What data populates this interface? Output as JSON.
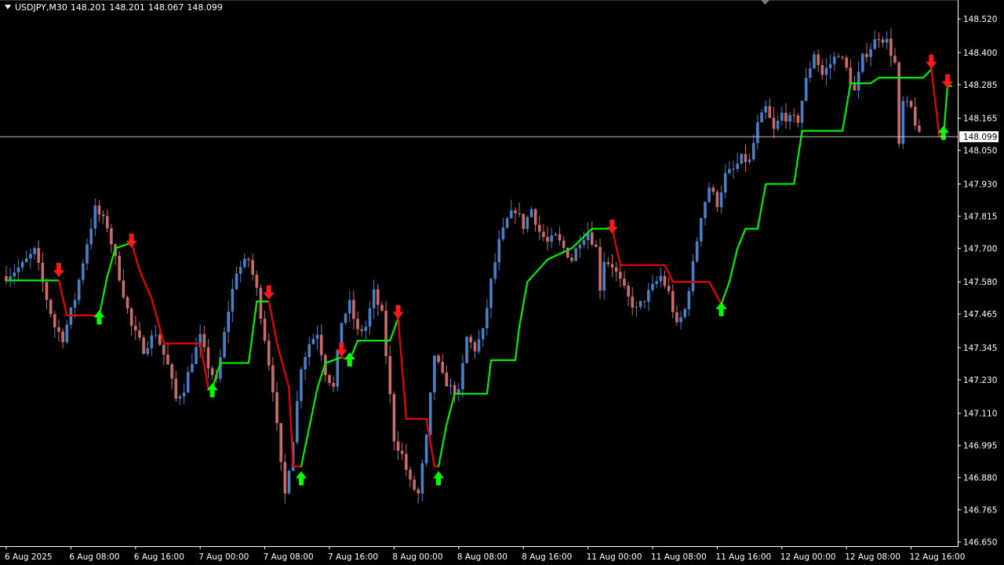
{
  "header": {
    "symbol": "USDJPY,M30",
    "open": "148.201",
    "high": "148.201",
    "low": "148.067",
    "close": "148.099"
  },
  "colors": {
    "background": "#000000",
    "frame": "#ffffff",
    "bull_candle": "#4a7fc6",
    "bear_candle": "#c96b6b",
    "trend_up": "#00ee00",
    "trend_down": "#ee0000",
    "arrow_up": "#00ff00",
    "arrow_down": "#ff1a1a",
    "price_line": "#c0c0c0",
    "text": "#ffffff"
  },
  "chart_data": {
    "type": "candlestick",
    "symbol": "USDJPY",
    "timeframe": "M30",
    "ylim": [
      146.635,
      148.585
    ],
    "grid": false,
    "current_price": "148.099",
    "y_ticks": [
      "148.520",
      "148.400",
      "148.285",
      "148.165",
      "148.050",
      "147.930",
      "147.815",
      "147.700",
      "147.580",
      "147.465",
      "147.345",
      "147.230",
      "147.110",
      "146.995",
      "146.880",
      "146.765",
      "146.650"
    ],
    "x_ticks": [
      "6 Aug 2025",
      "6 Aug 08:00",
      "6 Aug 16:00",
      "7 Aug 00:00",
      "7 Aug 08:00",
      "7 Aug 16:00",
      "8 Aug 00:00",
      "8 Aug 08:00",
      "8 Aug 16:00",
      "11 Aug 00:00",
      "11 Aug 08:00",
      "11 Aug 16:00",
      "12 Aug 00:00",
      "12 Aug 08:00",
      "12 Aug 16:00"
    ],
    "x_tick_bar_index": [
      0,
      16,
      32,
      48,
      64,
      80,
      96,
      112,
      128,
      144,
      160,
      176,
      192,
      208,
      224
    ],
    "path": [
      [
        0,
        147.6
      ],
      [
        4,
        147.64
      ],
      [
        7,
        147.69
      ],
      [
        10,
        147.52
      ],
      [
        12,
        147.42
      ],
      [
        14,
        147.38
      ],
      [
        17,
        147.52
      ],
      [
        20,
        147.72
      ],
      [
        22,
        147.84
      ],
      [
        25,
        147.78
      ],
      [
        28,
        147.6
      ],
      [
        31,
        147.42
      ],
      [
        34,
        147.34
      ],
      [
        37,
        147.4
      ],
      [
        40,
        147.28
      ],
      [
        42,
        147.16
      ],
      [
        44,
        147.2
      ],
      [
        46,
        147.3
      ],
      [
        48,
        147.38
      ],
      [
        50,
        147.28
      ],
      [
        52,
        147.22
      ],
      [
        55,
        147.48
      ],
      [
        57,
        147.62
      ],
      [
        60,
        147.66
      ],
      [
        62,
        147.55
      ],
      [
        64,
        147.38
      ],
      [
        66,
        147.2
      ],
      [
        68,
        146.92
      ],
      [
        69,
        146.82
      ],
      [
        71,
        147.02
      ],
      [
        73,
        147.28
      ],
      [
        75,
        147.36
      ],
      [
        77,
        147.4
      ],
      [
        79,
        147.26
      ],
      [
        81,
        147.2
      ],
      [
        83,
        147.44
      ],
      [
        85,
        147.5
      ],
      [
        87,
        147.4
      ],
      [
        89,
        147.42
      ],
      [
        91,
        147.54
      ],
      [
        93,
        147.46
      ],
      [
        94,
        147.32
      ],
      [
        96,
        147.02
      ],
      [
        98,
        146.96
      ],
      [
        100,
        146.86
      ],
      [
        102,
        146.82
      ],
      [
        104,
        147.02
      ],
      [
        106,
        147.32
      ],
      [
        108,
        147.24
      ],
      [
        110,
        147.2
      ],
      [
        112,
        147.18
      ],
      [
        114,
        147.38
      ],
      [
        116,
        147.34
      ],
      [
        118,
        147.4
      ],
      [
        120,
        147.58
      ],
      [
        122,
        147.72
      ],
      [
        124,
        147.8
      ],
      [
        126,
        147.84
      ],
      [
        128,
        147.78
      ],
      [
        130,
        147.84
      ],
      [
        132,
        147.76
      ],
      [
        134,
        147.72
      ],
      [
        136,
        147.74
      ],
      [
        138,
        147.7
      ],
      [
        140,
        147.66
      ],
      [
        142,
        147.73
      ],
      [
        144,
        147.76
      ],
      [
        146,
        147.7
      ],
      [
        147,
        147.56
      ],
      [
        148,
        147.66
      ],
      [
        150,
        147.64
      ],
      [
        152,
        147.58
      ],
      [
        154,
        147.52
      ],
      [
        156,
        147.48
      ],
      [
        158,
        147.52
      ],
      [
        160,
        147.56
      ],
      [
        162,
        147.6
      ],
      [
        164,
        147.54
      ],
      [
        166,
        147.42
      ],
      [
        168,
        147.48
      ],
      [
        170,
        147.64
      ],
      [
        172,
        147.82
      ],
      [
        174,
        147.92
      ],
      [
        176,
        147.86
      ],
      [
        178,
        147.96
      ],
      [
        180,
        147.98
      ],
      [
        182,
        148.02
      ],
      [
        184,
        148.01
      ],
      [
        186,
        148.14
      ],
      [
        188,
        148.2
      ],
      [
        190,
        148.12
      ],
      [
        192,
        148.18
      ],
      [
        194,
        148.16
      ],
      [
        196,
        148.16
      ],
      [
        198,
        148.3
      ],
      [
        200,
        148.4
      ],
      [
        202,
        148.32
      ],
      [
        204,
        148.36
      ],
      [
        206,
        148.4
      ],
      [
        208,
        148.34
      ],
      [
        210,
        148.26
      ],
      [
        212,
        148.38
      ],
      [
        214,
        148.42
      ],
      [
        216,
        148.46
      ],
      [
        218,
        148.44
      ],
      [
        220,
        148.36
      ],
      [
        221,
        148.06
      ],
      [
        222,
        148.22
      ],
      [
        224,
        148.2
      ],
      [
        226,
        148.1
      ]
    ],
    "arrows": [
      {
        "bar": 13,
        "direction": "down",
        "price": 147.625
      },
      {
        "bar": 23,
        "direction": "up",
        "price": 147.45
      },
      {
        "bar": 31,
        "direction": "down",
        "price": 147.73
      },
      {
        "bar": 51,
        "direction": "up",
        "price": 147.19
      },
      {
        "bar": 65,
        "direction": "down",
        "price": 147.545
      },
      {
        "bar": 73,
        "direction": "up",
        "price": 146.875
      },
      {
        "bar": 83,
        "direction": "down",
        "price": 147.34
      },
      {
        "bar": 85,
        "direction": "up",
        "price": 147.3
      },
      {
        "bar": 97,
        "direction": "down",
        "price": 147.475
      },
      {
        "bar": 107,
        "direction": "up",
        "price": 146.875
      },
      {
        "bar": 150,
        "direction": "down",
        "price": 147.78
      },
      {
        "bar": 177,
        "direction": "up",
        "price": 147.48
      },
      {
        "bar": 229,
        "direction": "down",
        "price": 148.37
      },
      {
        "bar": 232,
        "direction": "up",
        "price": 148.11
      },
      {
        "bar": 233,
        "direction": "down",
        "price": 148.3
      }
    ],
    "trend_line": [
      [
        0,
        147.585,
        "up"
      ],
      [
        13,
        147.585,
        "up"
      ],
      [
        13,
        147.585,
        "down"
      ],
      [
        15,
        147.46,
        "down"
      ],
      [
        20,
        147.46,
        "down"
      ],
      [
        23,
        147.46,
        "down"
      ],
      [
        23,
        147.46,
        "up"
      ],
      [
        25,
        147.6,
        "up"
      ],
      [
        27,
        147.7,
        "up"
      ],
      [
        31,
        147.72,
        "up"
      ],
      [
        31,
        147.72,
        "down"
      ],
      [
        33,
        147.62,
        "down"
      ],
      [
        36,
        147.52,
        "down"
      ],
      [
        39,
        147.36,
        "down"
      ],
      [
        48,
        147.36,
        "down"
      ],
      [
        50,
        147.2,
        "down"
      ],
      [
        51,
        147.2,
        "down"
      ],
      [
        51,
        147.2,
        "up"
      ],
      [
        53,
        147.29,
        "up"
      ],
      [
        60,
        147.29,
        "up"
      ],
      [
        62,
        147.51,
        "up"
      ],
      [
        65,
        147.51,
        "up"
      ],
      [
        65,
        147.51,
        "down"
      ],
      [
        67,
        147.36,
        "down"
      ],
      [
        70,
        147.2,
        "down"
      ],
      [
        71,
        146.92,
        "down"
      ],
      [
        73,
        146.92,
        "down"
      ],
      [
        73,
        146.92,
        "up"
      ],
      [
        75,
        147.06,
        "up"
      ],
      [
        77,
        147.2,
        "up"
      ],
      [
        79,
        147.29,
        "up"
      ],
      [
        83,
        147.31,
        "up"
      ],
      [
        83,
        147.31,
        "down"
      ],
      [
        85,
        147.3,
        "down"
      ],
      [
        85,
        147.3,
        "up"
      ],
      [
        87,
        147.37,
        "up"
      ],
      [
        95,
        147.37,
        "up"
      ],
      [
        97,
        147.45,
        "up"
      ],
      [
        97,
        147.45,
        "down"
      ],
      [
        99,
        147.09,
        "down"
      ],
      [
        104,
        147.09,
        "down"
      ],
      [
        106,
        146.92,
        "down"
      ],
      [
        107,
        146.92,
        "down"
      ],
      [
        107,
        146.92,
        "up"
      ],
      [
        109,
        147.07,
        "up"
      ],
      [
        111,
        147.18,
        "up"
      ],
      [
        119,
        147.18,
        "up"
      ],
      [
        120,
        147.3,
        "up"
      ],
      [
        126,
        147.3,
        "up"
      ],
      [
        127,
        147.42,
        "up"
      ],
      [
        129,
        147.58,
        "up"
      ],
      [
        134,
        147.66,
        "up"
      ],
      [
        140,
        147.7,
        "up"
      ],
      [
        145,
        147.77,
        "up"
      ],
      [
        150,
        147.77,
        "up"
      ],
      [
        150,
        147.77,
        "down"
      ],
      [
        152,
        147.64,
        "down"
      ],
      [
        163,
        147.64,
        "down"
      ],
      [
        165,
        147.58,
        "down"
      ],
      [
        174,
        147.58,
        "down"
      ],
      [
        177,
        147.5,
        "down"
      ],
      [
        177,
        147.5,
        "up"
      ],
      [
        179,
        147.58,
        "up"
      ],
      [
        181,
        147.7,
        "up"
      ],
      [
        183,
        147.77,
        "up"
      ],
      [
        186,
        147.77,
        "up"
      ],
      [
        188,
        147.93,
        "up"
      ],
      [
        195,
        147.93,
        "up"
      ],
      [
        197,
        148.12,
        "up"
      ],
      [
        207,
        148.12,
        "up"
      ],
      [
        209,
        148.29,
        "up"
      ],
      [
        214,
        148.29,
        "up"
      ],
      [
        216,
        148.31,
        "up"
      ],
      [
        227,
        148.31,
        "up"
      ],
      [
        229,
        148.34,
        "up"
      ],
      [
        229,
        148.34,
        "down"
      ],
      [
        231,
        148.1,
        "down"
      ],
      [
        232,
        148.1,
        "down"
      ],
      [
        232,
        148.1,
        "up"
      ],
      [
        233,
        148.28,
        "up"
      ],
      [
        234,
        148.28,
        "up"
      ]
    ]
  }
}
